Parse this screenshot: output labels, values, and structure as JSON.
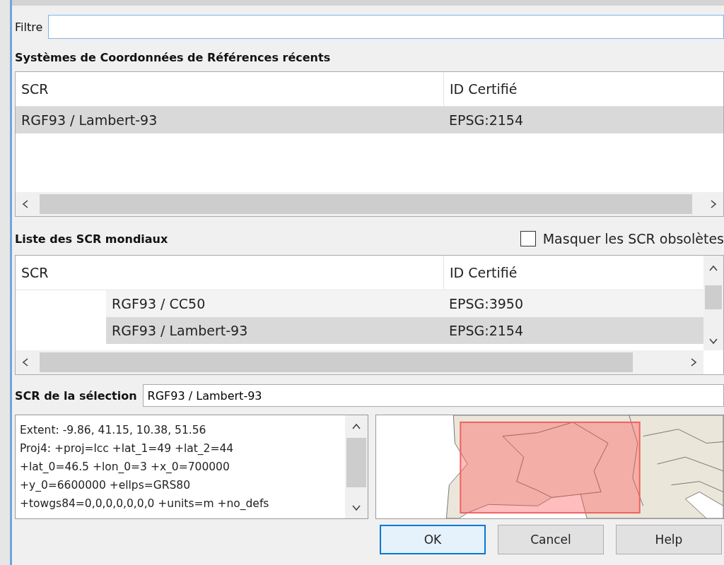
{
  "filter": {
    "label": "Filtre"
  },
  "recent": {
    "title": "Systèmes de Coordonnées de Références récents",
    "columns": [
      "SCR",
      "ID Certifié"
    ],
    "rows": [
      {
        "name": "RGF93 / Lambert-93",
        "id": "EPSG:2154",
        "selected": true
      }
    ]
  },
  "world": {
    "title": "Liste des SCR mondiaux",
    "hide_deprecated": {
      "label": "Masquer les SCR obsolètes",
      "checked": false
    },
    "columns": [
      "SCR",
      "ID Certifié"
    ],
    "rows": [
      {
        "name": "RGF93 / CC50",
        "id": "EPSG:3950",
        "selected": false
      },
      {
        "name": "RGF93 / Lambert-93",
        "id": "EPSG:2154",
        "selected": true
      }
    ]
  },
  "selection": {
    "label": "SCR de la sélection",
    "value": "RGF93 / Lambert-93"
  },
  "details": [
    "Extent: -9.86, 41.15, 10.38, 51.56",
    "Proj4: +proj=lcc +lat_1=49 +lat_2=44",
    "+lat_0=46.5 +lon_0=3 +x_0=700000",
    "+y_0=6600000 +ellps=GRS80",
    "+towgs84=0,0,0,0,0,0,0 +units=m +no_defs"
  ],
  "buttons": [
    {
      "label": "OK",
      "default": true
    },
    {
      "label": "Cancel",
      "default": false
    },
    {
      "label": "Help",
      "default": false
    }
  ]
}
